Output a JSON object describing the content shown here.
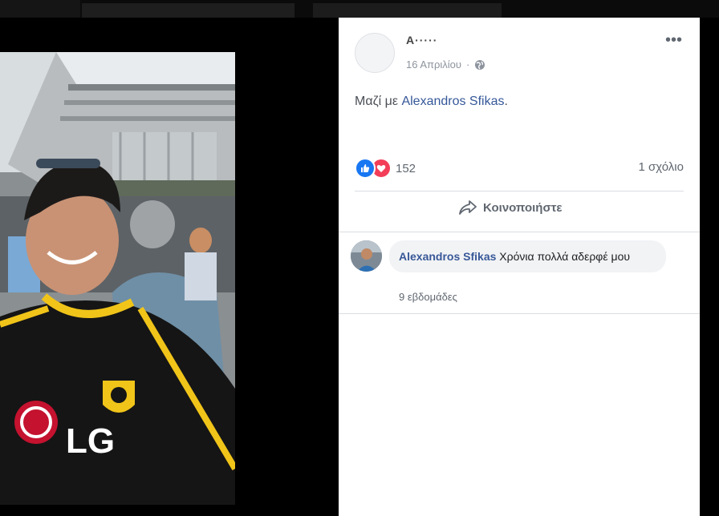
{
  "post": {
    "author": "Α·····",
    "date": "16 Απριλίου",
    "privacy_icon": "globe-icon",
    "more_icon": "ellipsis-icon",
    "text_prefix": "Μαζί με",
    "tagged_name": "Alexandros Sfikas",
    "text_suffix": "."
  },
  "reactions": {
    "count": "152",
    "types": [
      "like",
      "love"
    ],
    "comments_label": "1 σχόλιο"
  },
  "actions": {
    "share_label": "Κοινοποιήστε",
    "share_icon": "share-arrow-icon"
  },
  "comment": {
    "author": "Alexandros Sfikas",
    "text": "Χρόνια πολλά αδερφέ μου",
    "time": "9 εβδομάδες"
  },
  "colors": {
    "link": "#365899",
    "like": "#1877f2",
    "love": "#f33e58",
    "bubble": "#f2f3f5"
  }
}
